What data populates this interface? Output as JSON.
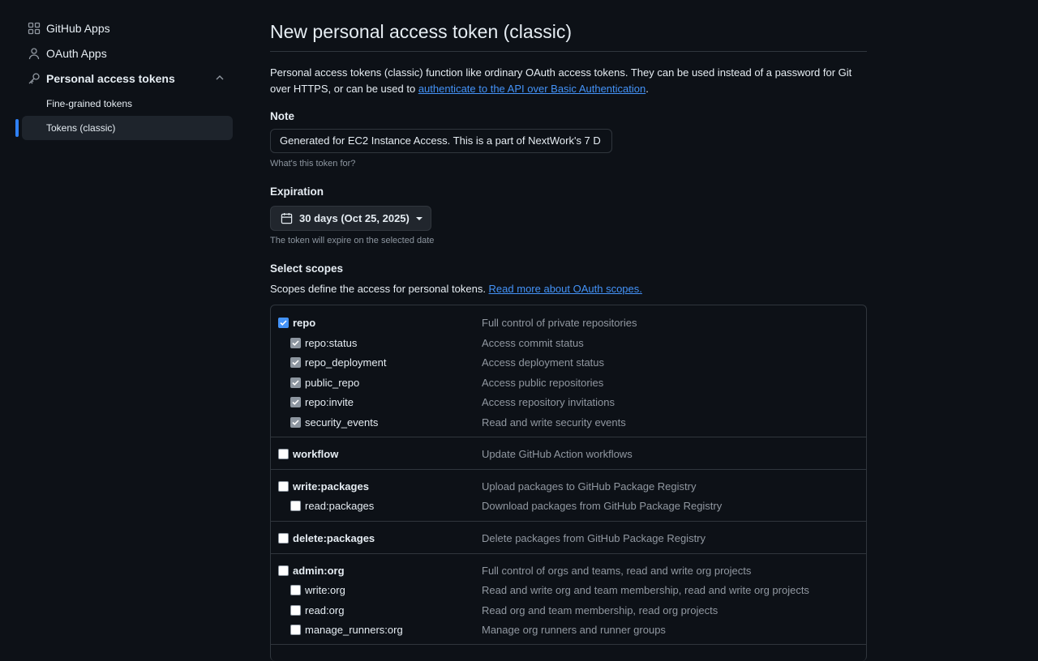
{
  "sidebar": {
    "items": [
      {
        "label": "GitHub Apps"
      },
      {
        "label": "OAuth Apps"
      },
      {
        "label": "Personal access tokens"
      },
      {
        "label": "Fine-grained tokens"
      },
      {
        "label": "Tokens (classic)"
      }
    ]
  },
  "main": {
    "title": "New personal access token (classic)",
    "intro_text": "Personal access tokens (classic) function like ordinary OAuth access tokens. They can be used instead of a password for Git over HTTPS, or can be used to ",
    "intro_link": "authenticate to the API over Basic Authentication",
    "intro_end": ".",
    "note": {
      "label": "Note",
      "value": "Generated for EC2 Instance Access. This is a part of NextWork's 7 D",
      "hint": "What's this token for?"
    },
    "expiration": {
      "label": "Expiration",
      "selected": "30 days (Oct 25, 2025)",
      "hint": "The token will expire on the selected date"
    },
    "scopes": {
      "label": "Select scopes",
      "desc": "Scopes define the access for personal tokens. ",
      "desc_link": "Read more about OAuth scopes.",
      "rows": [
        {
          "name": "repo",
          "desc": "Full control of private repositories",
          "checked": true
        },
        {
          "name": "repo:status",
          "desc": "Access commit status",
          "checked": true
        },
        {
          "name": "repo_deployment",
          "desc": "Access deployment status",
          "checked": true
        },
        {
          "name": "public_repo",
          "desc": "Access public repositories",
          "checked": true
        },
        {
          "name": "repo:invite",
          "desc": "Access repository invitations",
          "checked": true
        },
        {
          "name": "security_events",
          "desc": "Read and write security events",
          "checked": true
        },
        {
          "name": "workflow",
          "desc": "Update GitHub Action workflows",
          "checked": false
        },
        {
          "name": "write:packages",
          "desc": "Upload packages to GitHub Package Registry",
          "checked": false
        },
        {
          "name": "read:packages",
          "desc": "Download packages from GitHub Package Registry",
          "checked": false
        },
        {
          "name": "delete:packages",
          "desc": "Delete packages from GitHub Package Registry",
          "checked": false
        },
        {
          "name": "admin:org",
          "desc": "Full control of orgs and teams, read and write org projects",
          "checked": false
        },
        {
          "name": "write:org",
          "desc": "Read and write org and team membership, read and write org projects",
          "checked": false
        },
        {
          "name": "read:org",
          "desc": "Read org and team membership, read org projects",
          "checked": false
        },
        {
          "name": "manage_runners:org",
          "desc": "Manage org runners and runner groups",
          "checked": false
        }
      ]
    }
  },
  "colors": {
    "background": "#0d1117",
    "accent": "#4493f8",
    "border": "#30363d",
    "muted": "#8d96a0"
  }
}
